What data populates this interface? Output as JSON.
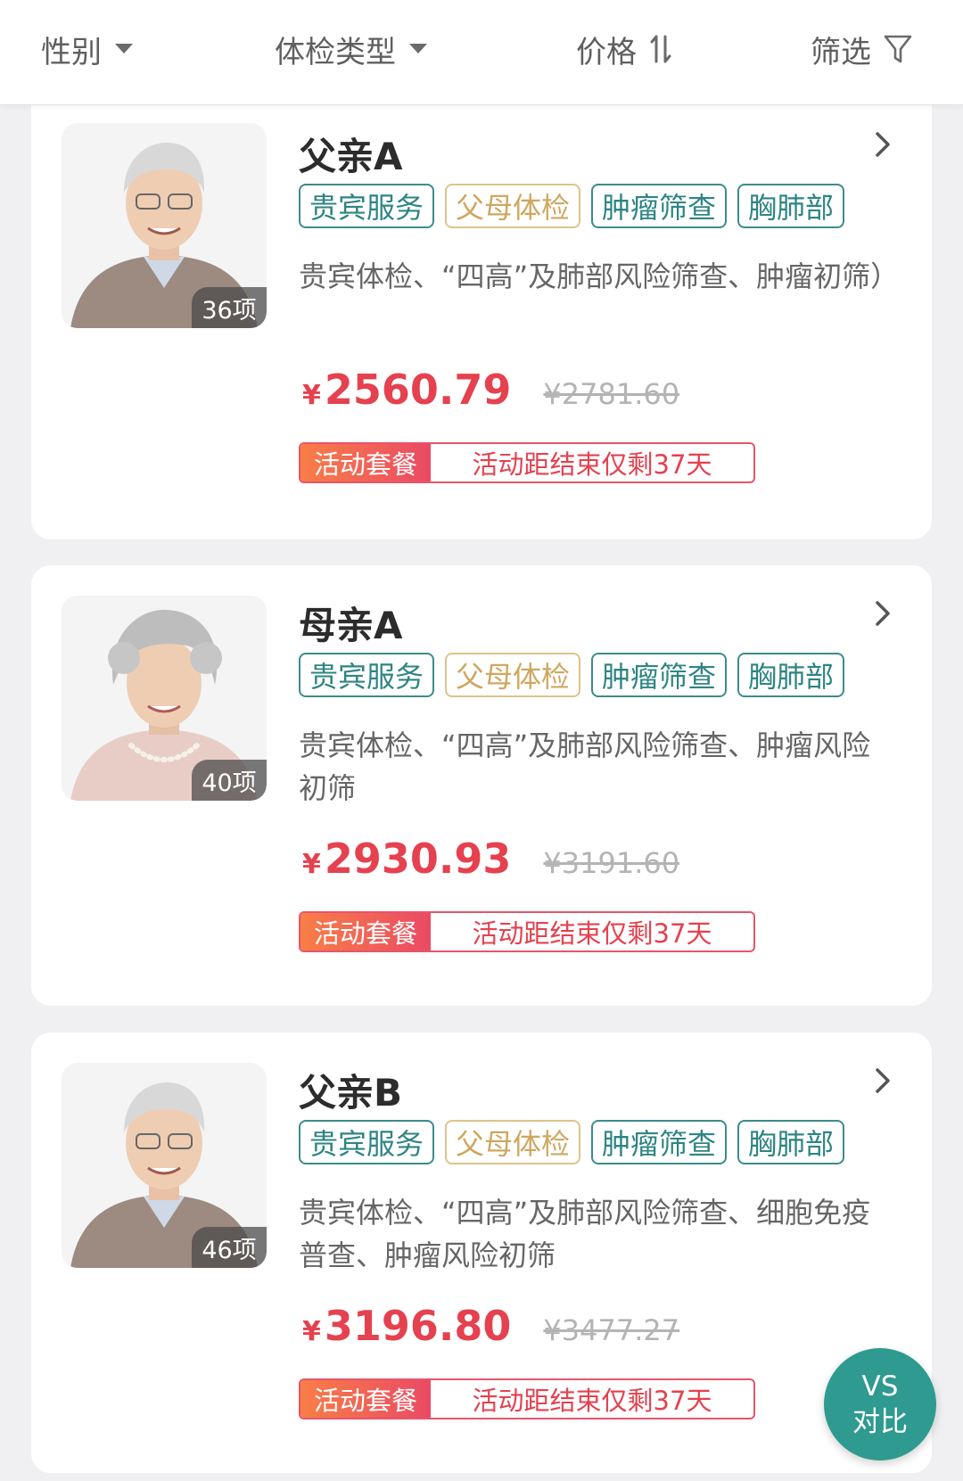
{
  "filter_bar": {
    "gender": "性别",
    "exam_type": "体检类型",
    "price": "价格",
    "filter": "筛选"
  },
  "colors": {
    "accent_teal": "#2e8583",
    "tag_gold": "#cfa760",
    "price_red": "#e5414f"
  },
  "packages": [
    {
      "title": "父亲A",
      "item_count": "36项",
      "tags": [
        "贵宾服务",
        "父母体检",
        "肿瘤筛查",
        "胸肺部"
      ],
      "description": "贵宾体检、“四高”及肺部风险筛查、肿瘤初筛）",
      "currency": "¥",
      "price": "2560.79",
      "original_price": "¥2781.60",
      "promo_label": "活动套餐",
      "promo_text": "活动距结束仅剩37天",
      "portrait": "elderly-man-portrait"
    },
    {
      "title": "母亲A",
      "item_count": "40项",
      "tags": [
        "贵宾服务",
        "父母体检",
        "肿瘤筛查",
        "胸肺部"
      ],
      "description": "贵宾体检、“四高”及肺部风险筛查、肿瘤风险初筛",
      "currency": "¥",
      "price": "2930.93",
      "original_price": "¥3191.60",
      "promo_label": "活动套餐",
      "promo_text": "活动距结束仅剩37天",
      "portrait": "elderly-woman-portrait"
    },
    {
      "title": "父亲B",
      "item_count": "46项",
      "tags": [
        "贵宾服务",
        "父母体检",
        "肿瘤筛查",
        "胸肺部"
      ],
      "description": "贵宾体检、“四高”及肺部风险筛查、细胞免疫普查、肿瘤风险初筛",
      "currency": "¥",
      "price": "3196.80",
      "original_price": "¥3477.27",
      "promo_label": "活动套餐",
      "promo_text": "活动距结束仅剩37天",
      "portrait": "elderly-man-portrait"
    }
  ],
  "compare_button": {
    "line1": "VS",
    "line2": "对比"
  }
}
